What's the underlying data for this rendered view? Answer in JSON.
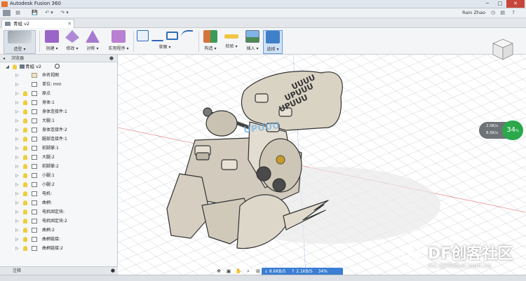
{
  "window": {
    "title": "Autodesk Fusion 360",
    "user": "Rain Zhao",
    "minimize": "─",
    "maximize": "□",
    "close": "✕"
  },
  "qat": {
    "undo_label": "↶ ▾",
    "redo_label": "↷ ▾",
    "save_label": "💾"
  },
  "document_tab": {
    "label": "青蛙 v2",
    "close": "✕"
  },
  "ribbon": {
    "groups": [
      {
        "name": "model-workspace",
        "label": "造型 ▾",
        "icon": "workspace-icon"
      },
      {
        "name": "create",
        "label": "创建 ▾",
        "icon": "create-icon"
      },
      {
        "name": "modify",
        "label": "修改 ▾",
        "icon": "modify-icon"
      },
      {
        "name": "mirror",
        "label": "对称 ▾",
        "icon": "mirror-icon"
      },
      {
        "name": "utilities",
        "label": "实用程序 ▾",
        "icon": "utilities-icon"
      },
      {
        "name": "sketch",
        "label": "草图 ▾",
        "icon": "sketch-icon"
      },
      {
        "name": "construct",
        "label": "构造 ▾",
        "icon": "construct-icon"
      },
      {
        "name": "inspect",
        "label": "检验 ▾",
        "icon": "inspect-icon"
      },
      {
        "name": "insert",
        "label": "插入 ▾",
        "icon": "insert-icon"
      },
      {
        "name": "select",
        "label": "选择 ▾",
        "icon": "select-icon"
      }
    ]
  },
  "browser": {
    "header": "浏览器",
    "root_label": "青蛙 v2",
    "items": [
      {
        "label": "命名视图",
        "type": "folder"
      },
      {
        "label": "单位: mm",
        "type": "units"
      },
      {
        "label": "原点"
      },
      {
        "label": "身体:1"
      },
      {
        "label": "身体连接件:1"
      },
      {
        "label": "大腿:1"
      },
      {
        "label": "身体连接件:2"
      },
      {
        "label": "腿部连接件:1"
      },
      {
        "label": "前脚掌:1"
      },
      {
        "label": "大腿:2"
      },
      {
        "label": "前脚掌:2"
      },
      {
        "label": "小腿:1"
      },
      {
        "label": "小腿:2"
      },
      {
        "label": "电机:"
      },
      {
        "label": "曲柄:"
      },
      {
        "label": "电机固定块:"
      },
      {
        "label": "电机固定块:2"
      },
      {
        "label": "曲柄:2"
      },
      {
        "label": "曲柄链接:"
      },
      {
        "label": "曲柄链接:2"
      }
    ]
  },
  "comments": {
    "label": "注释",
    "toggle": "●"
  },
  "netmon": {
    "up_rate": "2.0K/s",
    "down_rate": "8.5K/s",
    "percent": "34",
    "percent_unit": "%"
  },
  "speedbar": {
    "down": "↓ 8.6KB/S",
    "up": "↑ 2.1KB/S",
    "percent": "34%"
  },
  "model_text": {
    "top": "UUUU",
    "middle": "UPUUU"
  },
  "watermark": {
    "brand": "DF创客社区",
    "url": "mc.DFRobot.com.cn"
  },
  "colors": {
    "model_fill": "#d8d2c4",
    "model_stroke": "#3a3a3a",
    "accent_blue": "#3b7ed3",
    "net_green": "#2aa84a"
  }
}
